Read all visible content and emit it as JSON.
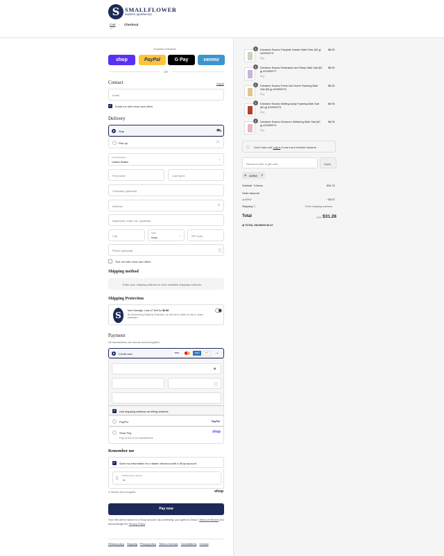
{
  "brand": {
    "name": "SMALLFLOWER",
    "tagline": "modern apothecary",
    "letter": "S"
  },
  "breadcrumb": {
    "cart": "Cart",
    "checkout": "Checkout",
    "check": "✓",
    "sep": "›"
  },
  "express": {
    "label": "Express checkout",
    "shop": "shop",
    "paypal": "PayPal",
    "gpay": "G Pay",
    "venmo": "venmo",
    "or": "OR"
  },
  "contact": {
    "title": "Contact",
    "login": "Log in",
    "email_placeholder": "Email",
    "news": "Email me with news and offers"
  },
  "delivery": {
    "title": "Delivery",
    "ship": "Ship",
    "pickup": "Pick up",
    "country_label": "Country/Region",
    "country": "United States",
    "first": "First name",
    "last": "Last name",
    "company": "Company (optional)",
    "address": "Address",
    "apt": "Apartment, suite, etc. (optional)",
    "city": "City",
    "state_label": "State",
    "state": "Iowa",
    "zip": "ZIP code",
    "phone": "Phone (optional)",
    "text_news": "Text me with news and offers"
  },
  "shipping_method": {
    "title": "Shipping method",
    "msg": "Enter your shipping address to view available shipping methods."
  },
  "protection": {
    "title": "Shipping Protection",
    "line1_pre": "from Damage, Loss & Theft for ",
    "line1_price": "$0.98",
    "line2": "By Deselecting Shipping Protection, we will not be liable for lost or stolen packages."
  },
  "payment": {
    "title": "Payment",
    "sub": "All transactions are secure and encrypted.",
    "credit": "Credit card",
    "cards": [
      "VISA",
      "MC",
      "AMEX",
      "DISC"
    ],
    "billing": "Use shipping address as billing address",
    "paypal": "PayPal",
    "paypal_logo": "PayPal",
    "shoppay": "Shop Pay",
    "shoppay_sub": "Pay in full or in installments",
    "shop_logo": "shop"
  },
  "remember": {
    "title": "Remember me",
    "save": "Save my information for a faster checkout with a Shop account",
    "mobile_label": "Mobile phone number",
    "mobile": "+1",
    "secure": "Secure and encrypted",
    "shop": "shop"
  },
  "pay_now": "Pay now",
  "legal": {
    "pre": "Your info will be saved to a Shop account. By continuing, you agree to Shop's ",
    "terms": "Terms of Service",
    "mid": " and acknowledge the ",
    "privacy": "Privacy Policy",
    "end": "."
  },
  "footer": [
    "Refund policy",
    "Shipping",
    "Privacy policy",
    "Terms of service",
    "Cancellations",
    "Contact"
  ],
  "cart": {
    "items": [
      {
        "name": "Dresdner Essenz Fairytale Garden Bath Elixir (60 g) #10090279",
        "size": "60 g",
        "qty": "1",
        "price": "$6.95"
      },
      {
        "name": "Dresdner Essenz Relaxation and Sleep Bath Salt (60 g) #10090277",
        "size": "60 g",
        "qty": "1",
        "price": "$6.95"
      },
      {
        "name": "Dresdner Essenz Feels Like Home Foaming Bath Salt (60 g) #10090276",
        "size": "60 g",
        "qty": "1",
        "price": "$6.95"
      },
      {
        "name": "Dresdner Essenz Melting Away Foaming Bath Salt (60 g) #10090275",
        "size": "60 g",
        "qty": "1",
        "price": "$6.95"
      },
      {
        "name": "Dresdner Essenz Women's Wellbeing Bath Salt (60 g) #10090274",
        "size": "60 g",
        "qty": "1",
        "price": "$6.95"
      }
    ],
    "rewards_pre": "Don't miss out! ",
    "rewards_link": "Log in",
    "rewards_post": " to earn and redeem rewards",
    "discount_placeholder": "Discount code or gift card",
    "apply": "Apply",
    "code": "ADBW",
    "subtotal_label": "Subtotal · 5 items",
    "subtotal": "$34.75",
    "order_discount": "Order discount",
    "code2": "ADBW",
    "discount": "− $3.47",
    "shipping_label": "Shipping",
    "shipping": "Enter shipping address",
    "total_label": "Total",
    "currency": "USD",
    "total": "$31.28",
    "savings_label": "TOTAL SAVINGS",
    "savings": "$3.47"
  },
  "colors": {
    "navy": "#1c2a57",
    "shop": "#5a31f4",
    "paypal": "#ffc439",
    "venmo": "#3d95ce",
    "gpay": "#000000"
  }
}
